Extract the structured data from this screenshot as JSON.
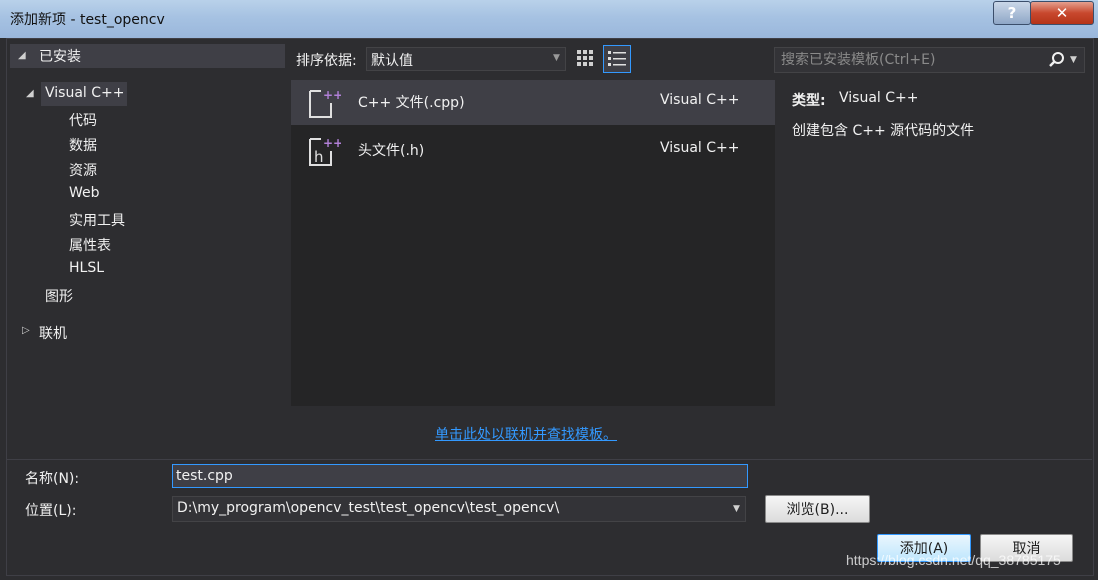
{
  "window": {
    "title": "添加新项 - test_opencv",
    "help_label": "?",
    "close_label": "✕"
  },
  "tree": {
    "installed": "已安装",
    "visual_cpp": "Visual C++",
    "children": [
      "代码",
      "数据",
      "资源",
      "Web",
      "实用工具",
      "属性表",
      "HLSL"
    ],
    "graphics": "图形",
    "online": "联机"
  },
  "toolbar": {
    "sort_label": "排序依据:",
    "sort_value": "默认值"
  },
  "search": {
    "placeholder": "搜索已安装模板(Ctrl+E)"
  },
  "templates": [
    {
      "name": "C++ 文件(.cpp)",
      "language": "Visual C++",
      "icon": "cpp-file-icon"
    },
    {
      "name": "头文件(.h)",
      "language": "Visual C++",
      "icon": "header-file-icon"
    }
  ],
  "details": {
    "type_label": "类型:",
    "type_value": "Visual C++",
    "description": "创建包含 C++ 源代码的文件"
  },
  "online_link": "单击此处以联机并查找模板。",
  "form": {
    "name_label": "名称(N):",
    "name_value": "test.cpp",
    "location_label": "位置(L):",
    "location_value": "D:\\my_program\\opencv_test\\test_opencv\\test_opencv\\",
    "browse_label": "浏览(B)...",
    "add_label": "添加(A)",
    "cancel_label": "取消"
  },
  "watermark": "https://blog.csdn.net/qq_38785175",
  "colors": {
    "background": "#2d2d30",
    "panel": "#252526",
    "selection": "#3f3f46",
    "accent": "#3399ff",
    "icon_accent": "#b180d7"
  }
}
